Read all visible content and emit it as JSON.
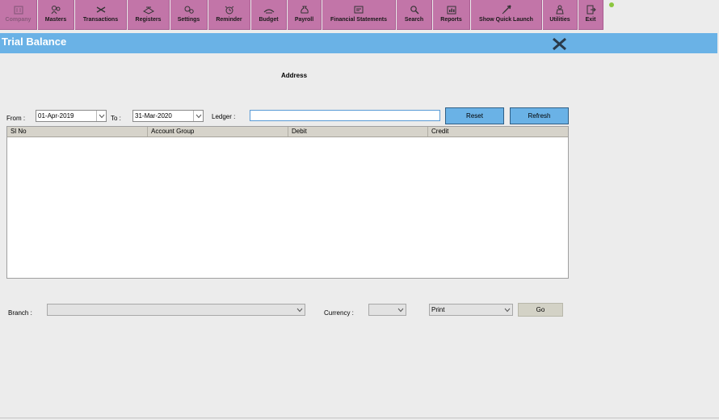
{
  "toolbar": {
    "items": [
      {
        "label": "Company",
        "icon": "company-icon",
        "disabled": true
      },
      {
        "label": "Masters",
        "icon": "masters-icon"
      },
      {
        "label": "Transactions",
        "icon": "transactions-icon"
      },
      {
        "label": "Registers",
        "icon": "registers-icon"
      },
      {
        "label": "Settings",
        "icon": "settings-icon"
      },
      {
        "label": "Reminder",
        "icon": "alarm-clock-icon"
      },
      {
        "label": "Budget",
        "icon": "budget-icon"
      },
      {
        "label": "Payroll",
        "icon": "money-bag-icon"
      },
      {
        "label": "Financial Statements",
        "icon": "statements-icon"
      },
      {
        "label": "Search",
        "icon": "search-icon"
      },
      {
        "label": "Reports",
        "icon": "reports-icon"
      },
      {
        "label": "Show Quick Launch",
        "icon": "rocket-icon"
      },
      {
        "label": "Utilities",
        "icon": "utilities-icon"
      },
      {
        "label": "Exit",
        "icon": "exit-icon"
      }
    ],
    "accent": "#c275a8"
  },
  "window": {
    "title": "Trial Balance",
    "title_color": "#6ab2e6",
    "address": "Address"
  },
  "filters": {
    "from_label": "From :",
    "from_value": "01-Apr-2019",
    "to_label": "To :",
    "to_value": "31-Mar-2020",
    "ledger_label": "Ledger :",
    "ledger_value": "",
    "reset_label": "Reset",
    "refresh_label": "Refresh"
  },
  "grid": {
    "columns": [
      "Sl No",
      "Account Group",
      "Debit",
      "Credit"
    ],
    "rows": []
  },
  "footer": {
    "branch_label": "Branch :",
    "branch_value": "",
    "currency_label": "Currency :",
    "currency_value": "",
    "print_value": "Print",
    "go_label": "Go"
  }
}
